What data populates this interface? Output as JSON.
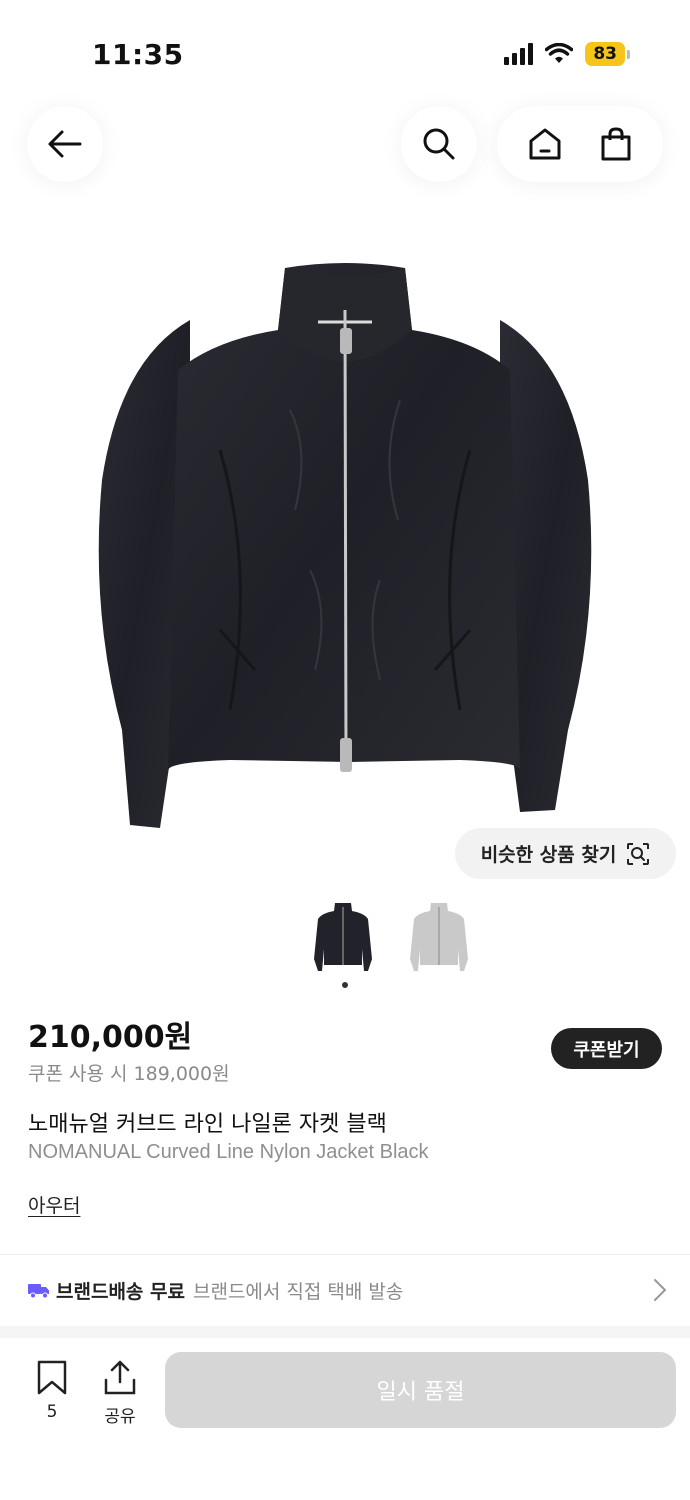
{
  "status": {
    "time": "11:35",
    "battery": "83"
  },
  "nav": {
    "back_icon": "arrow-left-icon",
    "search_icon": "search-icon",
    "home_icon": "home-icon",
    "cart_icon": "shopping-bag-icon"
  },
  "product": {
    "image": "black-zip-jacket",
    "similar_button": "비슷한 상품 찾기",
    "thumbnails": [
      "black-jacket",
      "gray-jacket"
    ],
    "price": "210,000원",
    "coupon_price": "쿠폰 사용 시 189,000원",
    "coupon_button": "쿠폰받기",
    "title_ko": "노매뉴얼 커브드 라인 나일론 자켓 블랙",
    "title_en": "NOMANUAL Curved Line Nylon Jacket Black",
    "category": "아우터"
  },
  "shipping": {
    "icon": "truck-icon",
    "label": "브랜드배송 무료",
    "description": "브랜드에서 직접 택배 발송"
  },
  "bottom": {
    "bookmark_count": "5",
    "share_label": "공유",
    "buy_label": "일시 품절"
  },
  "colors": {
    "battery": "#f5c518",
    "coupon_button_bg": "#222222",
    "buy_button_disabled": "#d6d6d6",
    "shipping_icon": "#6a5cff"
  }
}
